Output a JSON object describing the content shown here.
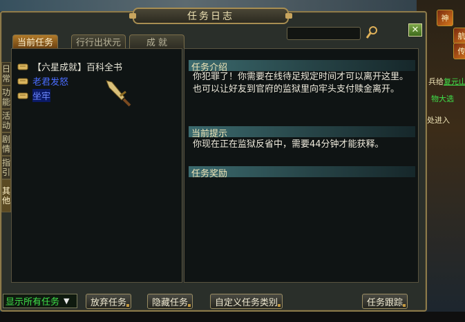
{
  "window": {
    "title": "任务日志",
    "close_label": "✕"
  },
  "tabs": [
    "当前任务",
    "行行出状元",
    "成 就"
  ],
  "side_tabs": [
    "日常",
    "功能",
    "活动",
    "剧情",
    "指引",
    "其他"
  ],
  "quest_list": [
    {
      "label": "【六星成就】百科全书",
      "style": "normal"
    },
    {
      "label": "老君发怒",
      "style": "link"
    },
    {
      "label": "坐牢",
      "style": "selected"
    }
  ],
  "detail": {
    "intro_header": "任务介绍",
    "intro_text": "你犯罪了！你需要在线待足规定时间才可以离开这里。也可以让好友到官府的监狱里向牢头支付赎金离开。",
    "hint_header": "当前提示",
    "hint_text": "你现在正在监狱反省中，需要44分钟才能获释。",
    "reward_header": "任务奖励"
  },
  "footer": {
    "filter_dropdown": "显示所有任务",
    "abandon_button": "放弃任务",
    "hide_button": "隐藏任务",
    "custom_category_button": "自定义任务类别",
    "track_button": "任务跟踪"
  },
  "hud": {
    "right_text_1": "兵给",
    "right_text_1_link": "复元山",
    "right_text_2": "物大选",
    "right_text_3": "处进入",
    "icons": [
      "神",
      "航",
      "传"
    ]
  },
  "colors": {
    "frame": "#8c7a4a",
    "active_tab": "#b07a2a",
    "link_blue": "#4a6cff",
    "section_teal": "#3b6a6e",
    "dropdown_green": "#3fe24a"
  }
}
